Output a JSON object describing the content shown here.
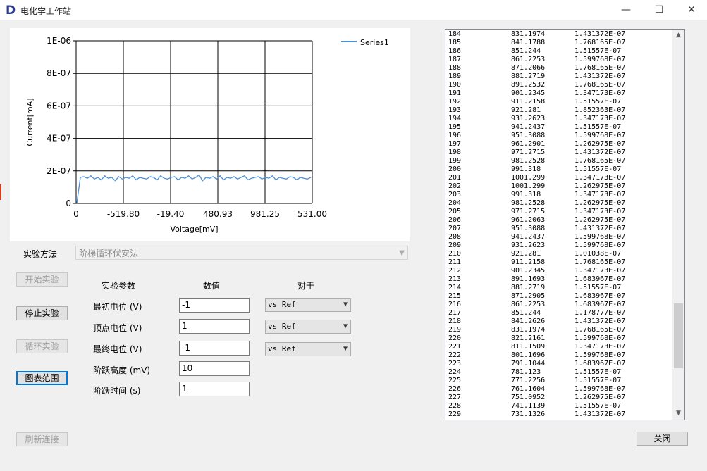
{
  "app": {
    "logo": "D",
    "title": "电化学工作站"
  },
  "window_controls": {
    "minimize": "—",
    "maximize": "☐",
    "close": "✕"
  },
  "chart_data": {
    "type": "line",
    "xlabel": "Voltage[mV]",
    "ylabel": "Current[mA]",
    "x_tick_labels": [
      "0",
      "-519.80",
      "-19.40",
      "480.93",
      "981.25",
      "531.00"
    ],
    "y_tick_labels": [
      "0",
      "2E-07",
      "4E-07",
      "6E-07",
      "8E-07",
      "1E-06"
    ],
    "ylim": [
      0,
      1e-06
    ],
    "grid": true,
    "legend_position": "top-right",
    "series": [
      {
        "name": "Series1",
        "color": "#4a90d9",
        "values": [
          0,
          1.6e-07,
          1.65e-07,
          1.55e-07,
          1.7e-07,
          1.5e-07,
          1.6e-07,
          1.45e-07,
          1.7e-07,
          1.55e-07,
          1.6e-07,
          1.4e-07,
          1.65e-07,
          1.5e-07,
          1.6e-07,
          1.55e-07,
          1.7e-07,
          1.45e-07,
          1.6e-07,
          1.55e-07,
          1.5e-07,
          1.65e-07,
          1.6e-07,
          1.45e-07,
          1.7e-07,
          1.55e-07,
          1.5e-07,
          1.6e-07,
          1.65e-07,
          1.45e-07,
          1.6e-07,
          1.55e-07,
          1.7e-07,
          1.5e-07,
          1.6e-07,
          1.75e-07,
          1.4e-07,
          1.6e-07,
          1.55e-07,
          1.65e-07,
          1.5e-07,
          1.7e-07,
          1.45e-07,
          1.6e-07,
          1.55e-07,
          1.65e-07,
          1.5e-07,
          1.6e-07,
          1.7e-07,
          1.45e-07,
          1.55e-07,
          1.6e-07,
          1.65e-07,
          1.5e-07,
          1.6e-07,
          1.55e-07,
          1.7e-07,
          1.45e-07,
          1.6e-07,
          1.55e-07,
          1.5e-07,
          1.65e-07,
          1.6e-07,
          1.45e-07,
          1.6e-07,
          1.55e-07,
          1.5e-07,
          1.6e-07
        ]
      }
    ]
  },
  "method": {
    "label": "实验方法",
    "value": "阶梯循环伏安法"
  },
  "buttons": {
    "start": "开始实验",
    "stop": "停止实验",
    "loop": "循环实验",
    "range": "图表范围",
    "refresh": "刷新连接",
    "close": "关闭"
  },
  "params": {
    "headers": {
      "name": "实验参数",
      "value": "数值",
      "vs": "对于"
    },
    "rows": [
      {
        "label": "最初电位 (V)",
        "value": "-1",
        "vs": "vs Ref"
      },
      {
        "label": "顶点电位 (V)",
        "value": "1",
        "vs": "vs Ref"
      },
      {
        "label": "最终电位 (V)",
        "value": "-1",
        "vs": "vs Ref"
      },
      {
        "label": "阶跃高度 (mV)",
        "value": "10"
      },
      {
        "label": "阶跃时间 (s)",
        "value": "1"
      }
    ]
  },
  "data_list": {
    "rows": [
      [
        "184",
        "831.1974",
        "1.431372E-07"
      ],
      [
        "185",
        "841.1788",
        "1.768165E-07"
      ],
      [
        "186",
        "851.244",
        "1.51557E-07"
      ],
      [
        "187",
        "861.2253",
        "1.599768E-07"
      ],
      [
        "188",
        "871.2066",
        "1.768165E-07"
      ],
      [
        "189",
        "881.2719",
        "1.431372E-07"
      ],
      [
        "190",
        "891.2532",
        "1.768165E-07"
      ],
      [
        "191",
        "901.2345",
        "1.347173E-07"
      ],
      [
        "192",
        "911.2158",
        "1.51557E-07"
      ],
      [
        "193",
        "921.281",
        "1.852363E-07"
      ],
      [
        "194",
        "931.2623",
        "1.347173E-07"
      ],
      [
        "195",
        "941.2437",
        "1.51557E-07"
      ],
      [
        "196",
        "951.3088",
        "1.599768E-07"
      ],
      [
        "197",
        "961.2901",
        "1.262975E-07"
      ],
      [
        "198",
        "971.2715",
        "1.431372E-07"
      ],
      [
        "199",
        "981.2528",
        "1.768165E-07"
      ],
      [
        "200",
        "991.318",
        "1.51557E-07"
      ],
      [
        "201",
        "1001.299",
        "1.347173E-07"
      ],
      [
        "202",
        "1001.299",
        "1.262975E-07"
      ],
      [
        "203",
        "991.318",
        "1.347173E-07"
      ],
      [
        "204",
        "981.2528",
        "1.262975E-07"
      ],
      [
        "205",
        "971.2715",
        "1.347173E-07"
      ],
      [
        "206",
        "961.2063",
        "1.262975E-07"
      ],
      [
        "207",
        "951.3088",
        "1.431372E-07"
      ],
      [
        "208",
        "941.2437",
        "1.599768E-07"
      ],
      [
        "209",
        "931.2623",
        "1.599768E-07"
      ],
      [
        "210",
        "921.281",
        "1.01038E-07"
      ],
      [
        "211",
        "911.2158",
        "1.768165E-07"
      ],
      [
        "212",
        "901.2345",
        "1.347173E-07"
      ],
      [
        "213",
        "891.1693",
        "1.683967E-07"
      ],
      [
        "214",
        "881.2719",
        "1.51557E-07"
      ],
      [
        "215",
        "871.2905",
        "1.683967E-07"
      ],
      [
        "216",
        "861.2253",
        "1.683967E-07"
      ],
      [
        "217",
        "851.244",
        "1.178777E-07"
      ],
      [
        "218",
        "841.2626",
        "1.431372E-07"
      ],
      [
        "219",
        "831.1974",
        "1.768165E-07"
      ],
      [
        "220",
        "821.2161",
        "1.599768E-07"
      ],
      [
        "221",
        "811.1509",
        "1.347173E-07"
      ],
      [
        "222",
        "801.1696",
        "1.599768E-07"
      ],
      [
        "223",
        "791.1044",
        "1.683967E-07"
      ],
      [
        "224",
        "781.123",
        "1.51557E-07"
      ],
      [
        "225",
        "771.2256",
        "1.51557E-07"
      ],
      [
        "226",
        "761.1604",
        "1.599768E-07"
      ],
      [
        "227",
        "751.0952",
        "1.262975E-07"
      ],
      [
        "228",
        "741.1139",
        "1.51557E-07"
      ],
      [
        "229",
        "731.1326",
        "1.431372E-07"
      ]
    ]
  },
  "scrollbar": {
    "up": "▲",
    "down": "▼"
  }
}
